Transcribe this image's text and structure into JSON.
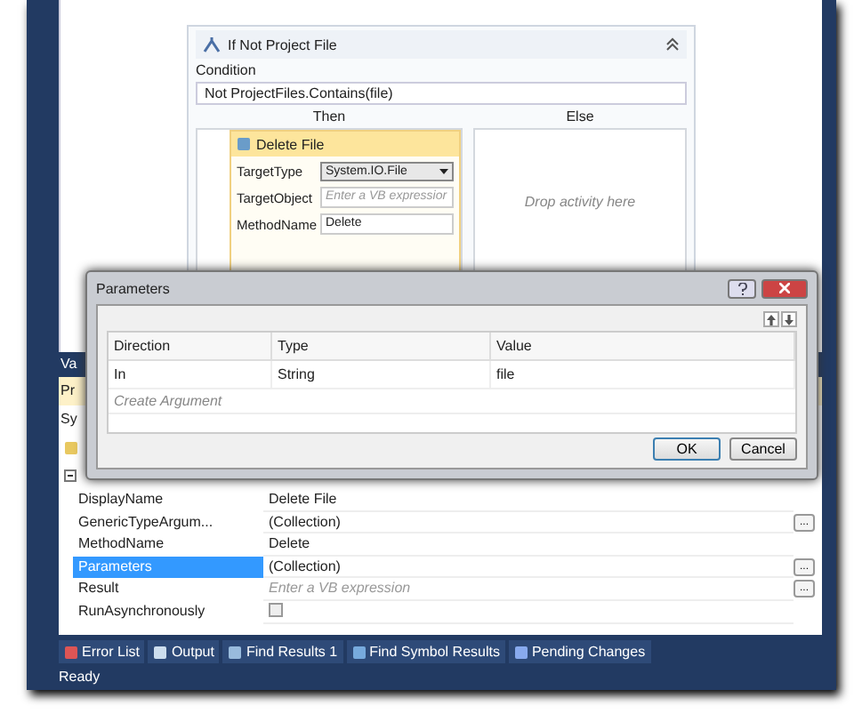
{
  "designer": {
    "activity": {
      "title": "If Not Project File",
      "expanded": true,
      "condition_label": "Condition",
      "condition": "Not ProjectFiles.Contains(file)",
      "then_label": "Then",
      "else_label": "Else",
      "else_hint": "Drop activity here",
      "then_activity": {
        "title": "Delete File",
        "fields": [
          {
            "kind": "select",
            "label": "TargetType",
            "value": "System.IO.File"
          },
          {
            "kind": "input",
            "label": "TargetObject",
            "placeholder": "Enter a VB expressior"
          },
          {
            "kind": "input",
            "label": "MethodName",
            "value": "Delete"
          }
        ]
      }
    }
  },
  "tool_window": {
    "title": "Va",
    "header": "Pr",
    "subheader": "Sy"
  },
  "properties": {
    "rows": [
      {
        "kind": "text",
        "name": "DisplayName",
        "value": "Delete File",
        "selected": false
      },
      {
        "kind": "text",
        "name": "GenericTypeArgum...",
        "value": "(Collection)",
        "action": "...",
        "selected": false
      },
      {
        "kind": "text",
        "name": "MethodName",
        "value": "Delete",
        "selected": false
      },
      {
        "kind": "text",
        "name": "Parameters",
        "value": "(Collection)",
        "action": "...",
        "selected": true
      },
      {
        "kind": "expression",
        "name": "Result",
        "placeholder": "Enter a VB expression",
        "action": "...",
        "selected": false
      },
      {
        "kind": "checkbox",
        "name": "RunAsynchronously",
        "checked": false,
        "selected": false
      }
    ]
  },
  "dialog": {
    "title": "Parameters",
    "columns": [
      "Direction",
      "Type",
      "Value"
    ],
    "rows": [
      {
        "direction": "In",
        "type": "String",
        "value": "file"
      }
    ],
    "new_row_hint": "Create Argument",
    "buttons": [
      {
        "label": "OK",
        "default": true
      },
      {
        "label": "Cancel",
        "default": false
      }
    ]
  },
  "tool_tabs": [
    {
      "label": "Error List"
    },
    {
      "label": "Output"
    },
    {
      "label": "Find Results 1"
    },
    {
      "label": "Find Symbol Results"
    },
    {
      "label": "Pending Changes"
    }
  ],
  "status_bar": "Ready"
}
